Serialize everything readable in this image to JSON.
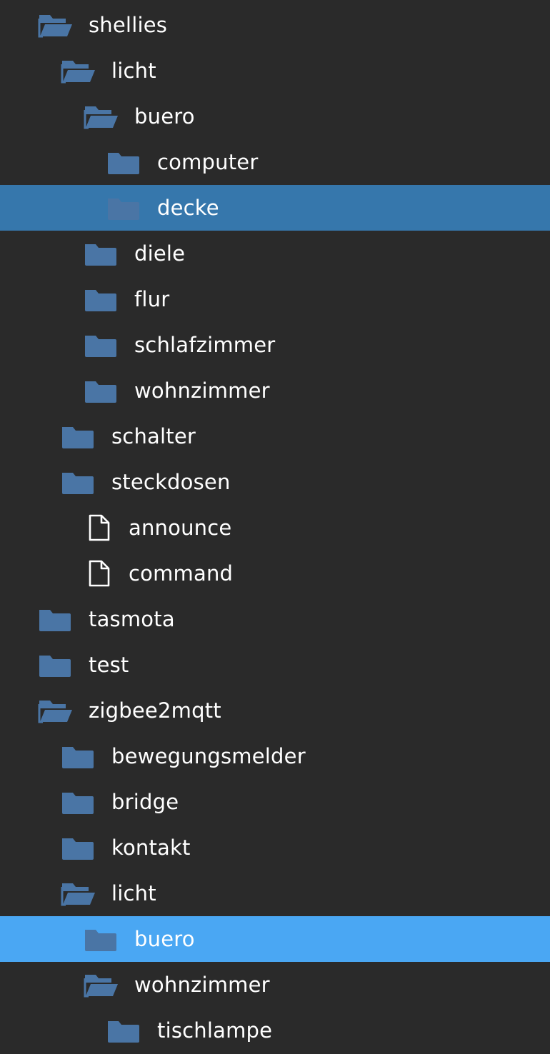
{
  "tree": {
    "items": [
      {
        "label": "shellies",
        "depth": 0,
        "kind": "folder-open",
        "state": "normal"
      },
      {
        "label": "licht",
        "depth": 1,
        "kind": "folder-open",
        "state": "normal"
      },
      {
        "label": "buero",
        "depth": 2,
        "kind": "folder-open",
        "state": "normal"
      },
      {
        "label": "computer",
        "depth": 3,
        "kind": "folder",
        "state": "normal"
      },
      {
        "label": "decke",
        "depth": 3,
        "kind": "folder",
        "state": "selected"
      },
      {
        "label": "diele",
        "depth": 2,
        "kind": "folder",
        "state": "normal"
      },
      {
        "label": "flur",
        "depth": 2,
        "kind": "folder",
        "state": "normal"
      },
      {
        "label": "schlafzimmer",
        "depth": 2,
        "kind": "folder",
        "state": "normal"
      },
      {
        "label": "wohnzimmer",
        "depth": 2,
        "kind": "folder",
        "state": "normal"
      },
      {
        "label": "schalter",
        "depth": 1,
        "kind": "folder",
        "state": "normal"
      },
      {
        "label": "steckdosen",
        "depth": 1,
        "kind": "folder",
        "state": "normal"
      },
      {
        "label": "announce",
        "depth": 1,
        "kind": "file",
        "state": "normal"
      },
      {
        "label": "command",
        "depth": 1,
        "kind": "file",
        "state": "normal"
      },
      {
        "label": "tasmota",
        "depth": 0,
        "kind": "folder",
        "state": "normal"
      },
      {
        "label": "test",
        "depth": 0,
        "kind": "folder",
        "state": "normal"
      },
      {
        "label": "zigbee2mqtt",
        "depth": 0,
        "kind": "folder-open",
        "state": "normal"
      },
      {
        "label": "bewegungsmelder",
        "depth": 1,
        "kind": "folder",
        "state": "normal"
      },
      {
        "label": "bridge",
        "depth": 1,
        "kind": "folder",
        "state": "normal"
      },
      {
        "label": "kontakt",
        "depth": 1,
        "kind": "folder",
        "state": "normal"
      },
      {
        "label": "licht",
        "depth": 1,
        "kind": "folder-open",
        "state": "normal"
      },
      {
        "label": "buero",
        "depth": 2,
        "kind": "folder",
        "state": "hover"
      },
      {
        "label": "wohnzimmer",
        "depth": 2,
        "kind": "folder-open",
        "state": "normal"
      },
      {
        "label": "tischlampe",
        "depth": 3,
        "kind": "folder",
        "state": "normal"
      }
    ]
  },
  "colors": {
    "background": "#2a2a2a",
    "folder_icon": "#4a75a5",
    "file_icon": "#ffffff",
    "text": "#ffffff",
    "selected_row": "#3677ac",
    "hover_row": "#4aa7f3"
  },
  "icons": {
    "folder": "folder-icon",
    "folder-open": "folder-open-icon",
    "file": "file-icon"
  }
}
